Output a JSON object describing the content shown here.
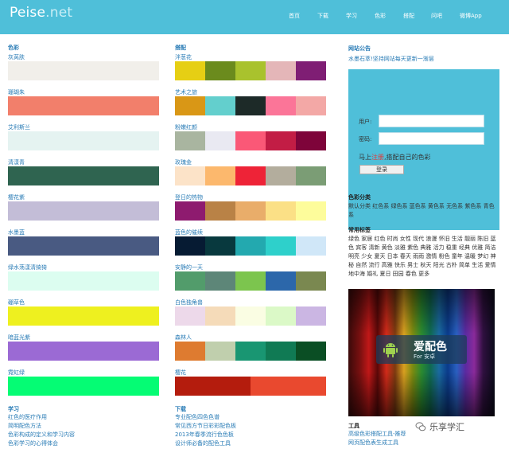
{
  "header": {
    "logo_main": "Peise",
    "logo_suffix": ".net",
    "nav": [
      "首页",
      "下载",
      "学习",
      "色彩",
      "搭配",
      "问吧",
      "微博App"
    ]
  },
  "colors_section": {
    "title": "色彩",
    "items": [
      {
        "name": "灰莴肤",
        "color": "#f1efea"
      },
      {
        "name": "珊瑚朱",
        "color": "#f27f6b"
      },
      {
        "name": "艾利斯兰",
        "color": "#e5f3f1"
      },
      {
        "name": "清漾青",
        "color": "#2f6450"
      },
      {
        "name": "樱花紫",
        "color": "#c3bdd7"
      },
      {
        "name": "水墨蓝",
        "color": "#495a82"
      },
      {
        "name": "绿水荡漾清猗猗",
        "color": "#dcfdf0"
      },
      {
        "name": "硼草色",
        "color": "#eef01f"
      },
      {
        "name": "暗蓝光紫",
        "color": "#9b6ad4"
      },
      {
        "name": "霓虹绿",
        "color": "#05fc74"
      }
    ]
  },
  "palettes_section": {
    "title": "搭配",
    "items": [
      {
        "name": "泮葱花",
        "colors": [
          "#e6cf14",
          "#6b8b1d",
          "#a9c22d",
          "#e4b6b8",
          "#7f1e74"
        ]
      },
      {
        "name": "艺术之旅",
        "colors": [
          "#d99716",
          "#63cfcd",
          "#1d2a28",
          "#fb7598",
          "#f3a8a6"
        ]
      },
      {
        "name": "粉嫩红颜",
        "colors": [
          "#a9b5a0",
          "#e9e9f2",
          "#fa5877",
          "#c21d45",
          "#7e043a"
        ]
      },
      {
        "name": "玫瑰金",
        "colors": [
          "#fce3c8",
          "#fcb86d",
          "#ee2337",
          "#b3ad9d",
          "#7b9d75"
        ]
      },
      {
        "name": "登日的热物",
        "colors": [
          "#8e1b6f",
          "#b98246",
          "#e9ad6a",
          "#fbe086",
          "#fdfc9b"
        ]
      },
      {
        "name": "蓝色的催续",
        "colors": [
          "#061b33",
          "#08393e",
          "#23a9af",
          "#2ed0cb",
          "#d0e7f8"
        ]
      },
      {
        "name": "安静的一天",
        "colors": [
          "#529c6b",
          "#5d8678",
          "#7cc54e",
          "#2c67aa",
          "#7a8850"
        ]
      },
      {
        "name": "白色独角兽",
        "colors": [
          "#edd9ea",
          "#f5dbb9",
          "#fafde3",
          "#dbf9c7",
          "#cbb6e3"
        ]
      },
      {
        "name": "森林人",
        "colors": [
          "#de7b30",
          "#c0cfad",
          "#199672",
          "#107a54",
          "#0a4e24"
        ]
      },
      {
        "name": "樱花",
        "colors": [
          "#b41c0d",
          "#e9492f"
        ]
      }
    ]
  },
  "learning": {
    "title": "学习",
    "links": [
      "红色的医疗作用",
      "简明配色方法",
      "色彩构成的定义和学习内容",
      "色彩学习的心得体会"
    ]
  },
  "downloads": {
    "title": "下载",
    "links": [
      "专业配色四色色谱",
      "常见西方节日彩彩配色板",
      "2013年春季流行色色板",
      "设计师必备的配色工具"
    ]
  },
  "notice": {
    "title": "网站公告",
    "text": "水墨石萃!坚持网站每天更新一渐层"
  },
  "login": {
    "user_label": "用户:",
    "password_label": "密码:",
    "register_prefix": "马上",
    "register_link": "注册",
    "register_suffix": ",搭配自己的色彩",
    "login_button": "登录"
  },
  "categories": {
    "title": "色彩分类",
    "text": "默认分类 红色系 绿色系 蓝色系 黄色系 无色系 紫色系 青色系"
  },
  "tags": {
    "title": "常用标签",
    "text": "绿色 家居 红色 时尚 女性 现代 浪漫 怀旧 生活 靓丽 陈旧 蓝色 宾客 清新 黄色 淡雅 紫色 典雅 活力 稳重 经典 优雅 简洁 明亮 少女 夏天 日本 春天 雨雨 激情 粉色 童年 温暖 梦幻 神秘 自然 流行 高雅 快乐 男士 秋天 阳光 古朴 简单 生活 爱情 地中海 婚礼 夏日 田园 春色 更多"
  },
  "banner": {
    "app_name": "爱配色",
    "app_sub": "For 安卓",
    "icon": "android-icon"
  },
  "tools": {
    "title": "工具",
    "links": [
      "高级色彩搭配工具-推荐",
      "网页配色表生成工具"
    ]
  },
  "watermark": {
    "text": "乐享学汇"
  }
}
